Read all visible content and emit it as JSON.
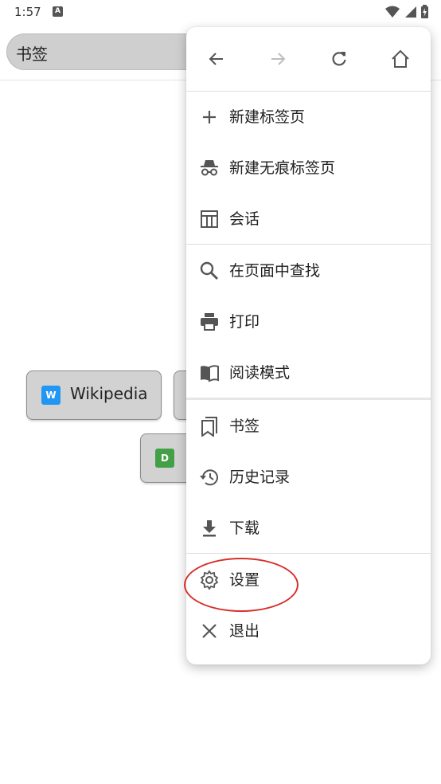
{
  "status_bar": {
    "time": "1:57",
    "notification_icon": "A"
  },
  "urlbar": {
    "text": "书签"
  },
  "bookmarks": [
    {
      "label": "Wikipedia",
      "icon_letter": "W",
      "icon_color": "#2196f3"
    },
    {
      "label": "",
      "icon_letter": ""
    },
    {
      "label": "",
      "icon_letter": "D",
      "icon_color": "#43a047"
    }
  ],
  "menu": {
    "nav": [
      "back-icon",
      "forward-icon",
      "reload-icon",
      "home-icon"
    ],
    "items": [
      {
        "label": "新建标签页",
        "icon": "plus-icon"
      },
      {
        "label": "新建无痕标签页",
        "icon": "incognito-icon"
      },
      {
        "label": "会话",
        "icon": "session-icon"
      },
      {
        "label": "在页面中查找",
        "icon": "search-icon"
      },
      {
        "label": "打印",
        "icon": "print-icon"
      },
      {
        "label": "阅读模式",
        "icon": "book-icon"
      },
      {
        "label": "书签",
        "icon": "bookmarks-icon"
      },
      {
        "label": "历史记录",
        "icon": "history-icon"
      },
      {
        "label": "下载",
        "icon": "download-icon"
      },
      {
        "label": "设置",
        "icon": "gear-icon"
      },
      {
        "label": "退出",
        "icon": "close-icon"
      }
    ]
  },
  "colors": {
    "highlight": "#d8302b",
    "icon": "#555555",
    "disabled_icon": "#bdbdbd"
  }
}
